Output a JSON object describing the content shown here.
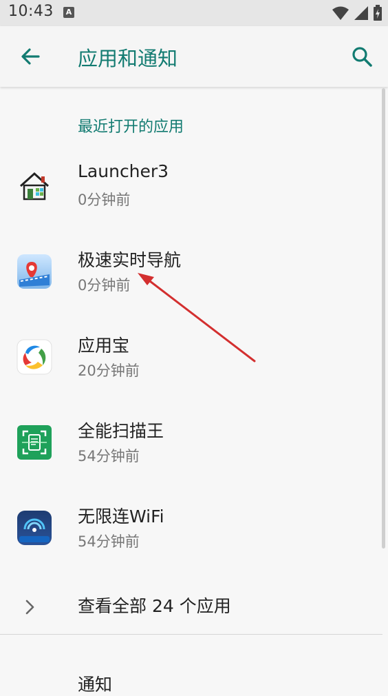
{
  "status_bar": {
    "time": "10:43",
    "notification_icon": "A"
  },
  "app_bar": {
    "title": "应用和通知"
  },
  "recent_apps": {
    "section_title": "最近打开的应用",
    "items": [
      {
        "name": "Launcher3",
        "time": "0分钟前",
        "icon": "house-icon"
      },
      {
        "name": "极速实时导航",
        "time": "0分钟前",
        "icon": "navigation-map-icon"
      },
      {
        "name": "应用宝",
        "time": "20分钟前",
        "icon": "app-store-icon"
      },
      {
        "name": "全能扫描王",
        "time": "54分钟前",
        "icon": "scanner-icon"
      },
      {
        "name": "无限连WiFi",
        "time": "54分钟前",
        "icon": "wifi-app-icon"
      }
    ]
  },
  "see_all": {
    "label": "查看全部 24 个应用"
  },
  "notifications": {
    "label": "通知"
  },
  "colors": {
    "accent": "#127b71",
    "arrow": "#d32f2f"
  }
}
